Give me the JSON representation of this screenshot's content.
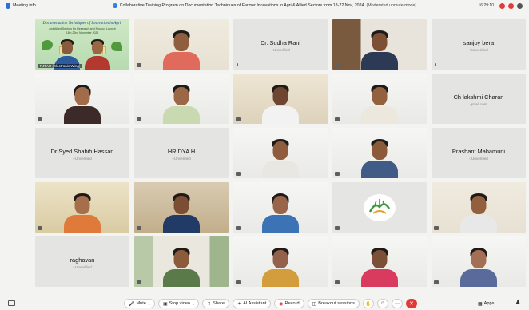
{
  "window": {
    "title_left": "Meeting info",
    "meeting_title": "Collaborative Training Program on Documentation Techniques of Farmer Innovations in Agri & Allied Sectors from 18-22 Nov, 2024",
    "mode": "(Moderated unmute mode)",
    "time": "16:29:10"
  },
  "banner": {
    "title": "Documentation Techniques of Innovation in Agri.",
    "line2": "and Allied Sectors for Research and Product Launch",
    "line3": "18th-22nd November 2024",
    "caption": "PJTAU (Electronic Wing)"
  },
  "participants": [
    {
      "id": "p1",
      "type": "banner"
    },
    {
      "id": "p2",
      "type": "video"
    },
    {
      "id": "p3",
      "type": "named",
      "name": "Dr. Sudha Rani",
      "status": "Unverified"
    },
    {
      "id": "p4",
      "type": "video"
    },
    {
      "id": "p5",
      "type": "named",
      "name": "sanjoy bera",
      "status": "Unverified"
    },
    {
      "id": "p6",
      "type": "video"
    },
    {
      "id": "p7",
      "type": "video"
    },
    {
      "id": "p8",
      "type": "video"
    },
    {
      "id": "p9",
      "type": "video"
    },
    {
      "id": "p10",
      "type": "named",
      "name": "Ch lakshmi Charan",
      "sub": "gmail.com"
    },
    {
      "id": "p11",
      "type": "named",
      "name": "Dr Syed Shabih Hassan",
      "status": "Unverified"
    },
    {
      "id": "p12",
      "type": "named",
      "name": "HRIDYA H",
      "status": "Unverified"
    },
    {
      "id": "p13",
      "type": "video"
    },
    {
      "id": "p14",
      "type": "video"
    },
    {
      "id": "p15",
      "type": "named",
      "name": "Prashant Mahamuni",
      "status": "Unverified"
    },
    {
      "id": "p16",
      "type": "video"
    },
    {
      "id": "p17",
      "type": "video"
    },
    {
      "id": "p18",
      "type": "video"
    },
    {
      "id": "p19",
      "type": "logo"
    },
    {
      "id": "p20",
      "type": "video"
    },
    {
      "id": "p21",
      "type": "named",
      "name": "raghavan",
      "status": "Unverified"
    },
    {
      "id": "p22",
      "type": "video"
    },
    {
      "id": "p23",
      "type": "video"
    },
    {
      "id": "p24",
      "type": "video"
    },
    {
      "id": "p25",
      "type": "video"
    }
  ],
  "toolbar": {
    "mute": "Mute",
    "stop_video": "Stop video",
    "share": "Share",
    "ai_assistant": "AI Assistant",
    "record": "Record",
    "breakout": "Breakout sessions",
    "apps": "Apps"
  },
  "colors": {
    "background": "#f3f3f1",
    "tile": "#e5e6e4",
    "end_call": "#e53935",
    "accent_blue": "#2166d6"
  }
}
